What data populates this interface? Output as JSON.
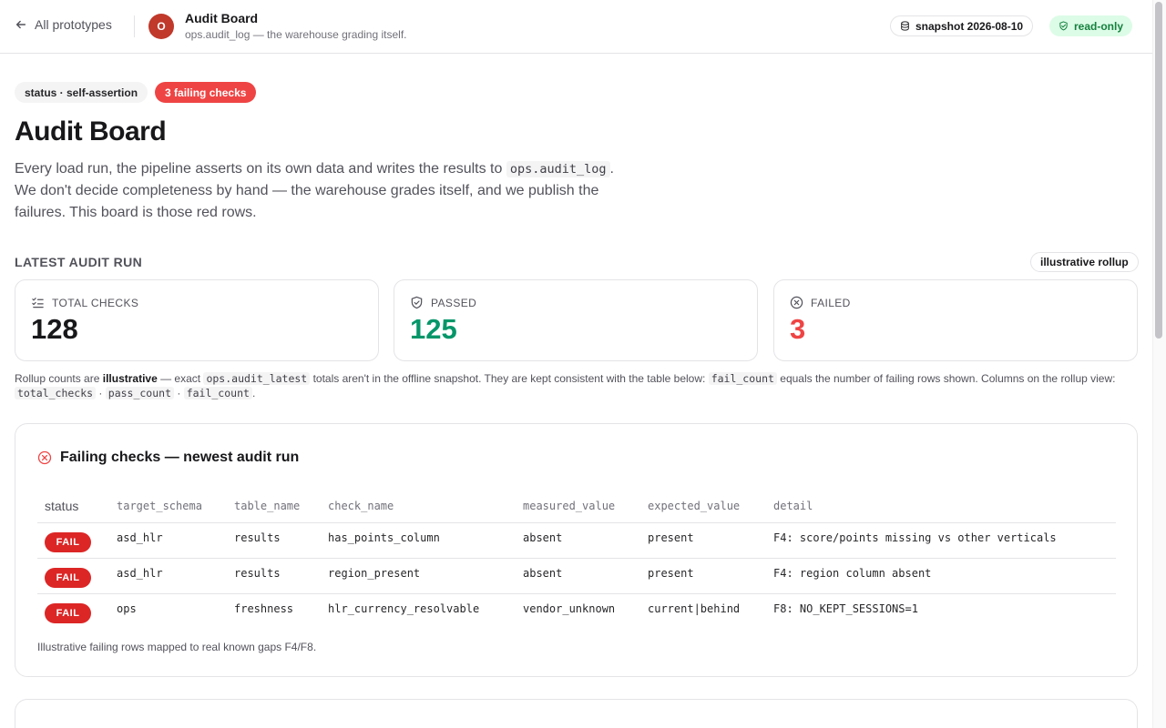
{
  "header": {
    "back_label": "All prototypes",
    "avatar_letter": "O",
    "app_title": "Audit Board",
    "app_subtitle": "ops.audit_log — the warehouse grading itself.",
    "snapshot_label": "snapshot 2026-08-10",
    "readonly_label": "read-only"
  },
  "hero": {
    "status_pill": "status · self-assertion",
    "failing_pill": "3 failing checks",
    "title": "Audit Board",
    "intro_1": "Every load run, the pipeline asserts on its own data and writes the results to",
    "intro_code": "ops.audit_log",
    "intro_2": ". We don't decide completeness by hand — the warehouse grades itself, and we publish the failures. This board is those red rows."
  },
  "latest": {
    "section_label": "LATEST AUDIT RUN",
    "rollup_chip": "illustrative rollup",
    "cards": [
      {
        "label": "TOTAL CHECKS",
        "value": "128",
        "icon": "checklist-icon"
      },
      {
        "label": "PASSED",
        "value": "125",
        "icon": "shield-check-icon"
      },
      {
        "label": "FAILED",
        "value": "3",
        "icon": "x-circle-icon"
      }
    ],
    "note": {
      "t1": "Rollup counts are ",
      "b1": "illustrative",
      "t2": " — exact ",
      "c1": "ops.audit_latest",
      "t3": " totals aren't in the offline snapshot. They are kept consistent with the table below: ",
      "c2": "fail_count",
      "t4": " equals the number of failing rows shown. Columns on the rollup view: ",
      "c3": "total_checks",
      "sep1": " · ",
      "c4": "pass_count",
      "sep2": " · ",
      "c5": "fail_count",
      "t5": "."
    }
  },
  "failing": {
    "title": "Failing checks — newest audit run",
    "columns": [
      "status",
      "target_schema",
      "table_name",
      "check_name",
      "measured_value",
      "expected_value",
      "detail"
    ],
    "rows": [
      {
        "status": "FAIL",
        "target_schema": "asd_hlr",
        "table_name": "results",
        "check_name": "has_points_column",
        "measured_value": "absent",
        "expected_value": "present",
        "detail": "F4: score/points missing vs other verticals"
      },
      {
        "status": "FAIL",
        "target_schema": "asd_hlr",
        "table_name": "results",
        "check_name": "region_present",
        "measured_value": "absent",
        "expected_value": "present",
        "detail": "F4: region column absent"
      },
      {
        "status": "FAIL",
        "target_schema": "ops",
        "table_name": "freshness",
        "check_name": "hlr_currency_resolvable",
        "measured_value": "vendor_unknown",
        "expected_value": "current|behind",
        "detail": "F8: NO_KEPT_SESSIONS=1"
      }
    ],
    "footnote": "Illustrative failing rows mapped to real known gaps F4/F8."
  },
  "colors": {
    "pass": "#059669",
    "fail": "#ef4444",
    "fail_badge": "#dc2626",
    "readonly_bg": "#dcfce7",
    "avatar": "#c0392b"
  }
}
